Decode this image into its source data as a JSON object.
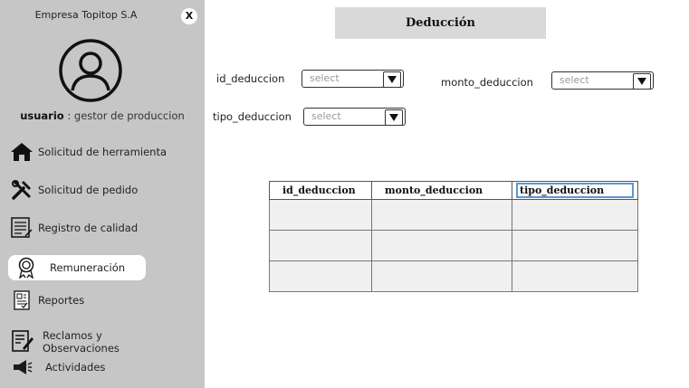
{
  "sidebar": {
    "company": "Empresa Topitop S.A",
    "close_label": "X",
    "user_label": "usuario",
    "user_role": " : gestor de produccion",
    "items": [
      {
        "label": "Solicitud de herramienta",
        "icon": "home-icon"
      },
      {
        "label": "Solicitud de pedido",
        "icon": "tools-icon"
      },
      {
        "label": "Registro de calidad",
        "icon": "checklist-icon"
      },
      {
        "label": "Remuneración",
        "icon": "award-icon",
        "active": true
      },
      {
        "label": "Reportes",
        "icon": "report-icon"
      },
      {
        "label": "Reclamos y\nObservaciones",
        "icon": "complaint-icon"
      },
      {
        "label": "Actividades",
        "icon": "megaphone-icon"
      }
    ]
  },
  "main": {
    "title": "Deducción",
    "fields": {
      "id_label": "id_deduccion",
      "id_placeholder": "select",
      "monto_label": "monto_deduccion",
      "monto_placeholder": "select",
      "tipo_label": "tipo_deduccion",
      "tipo_placeholder": "select"
    },
    "table": {
      "headers": [
        "id_deduccion",
        "monto_deduccion",
        "tipo_deduccion"
      ],
      "rows": [
        [
          "",
          "",
          ""
        ],
        [
          "",
          "",
          ""
        ],
        [
          "",
          "",
          ""
        ]
      ]
    }
  },
  "colors": {
    "sidebar": "#c6c6c6",
    "title_box": "#d9d9d9",
    "focus": "#5a97d6"
  }
}
